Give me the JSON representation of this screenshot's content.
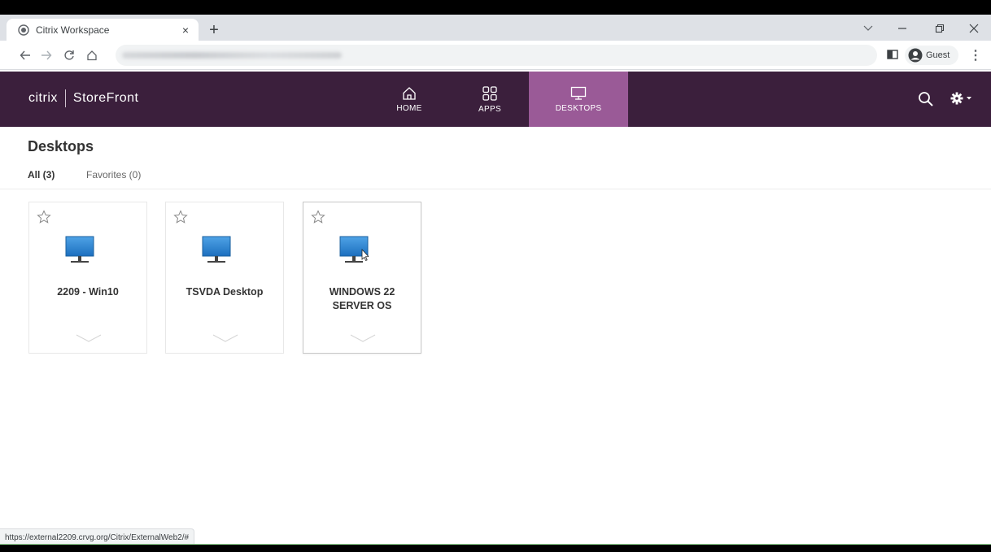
{
  "browser": {
    "tab_title": "Citrix Workspace",
    "tab_close": "×",
    "new_tab": "+",
    "profile_label": "Guest",
    "status_url": "https://external2209.crvg.org/Citrix/ExternalWeb2/#"
  },
  "header": {
    "brand_left": "citrix",
    "brand_right": "StoreFront",
    "nav": [
      {
        "label": "HOME",
        "icon": "home-icon",
        "active": false
      },
      {
        "label": "APPS",
        "icon": "apps-grid-icon",
        "active": false
      },
      {
        "label": "DESKTOPS",
        "icon": "desktop-icon",
        "active": true
      }
    ],
    "accent_color": "#9a5a97",
    "bar_color": "#3b1f3c"
  },
  "main": {
    "title": "Desktops",
    "filters": [
      {
        "label": "All (3)",
        "selected": true
      },
      {
        "label": "Favorites (0)",
        "selected": false
      }
    ],
    "cards": [
      {
        "label": "2209 - Win10",
        "favorite": false
      },
      {
        "label": "TSVDA Desktop",
        "favorite": false
      },
      {
        "label": "WINDOWS 22 SERVER OS",
        "favorite": false
      }
    ]
  }
}
